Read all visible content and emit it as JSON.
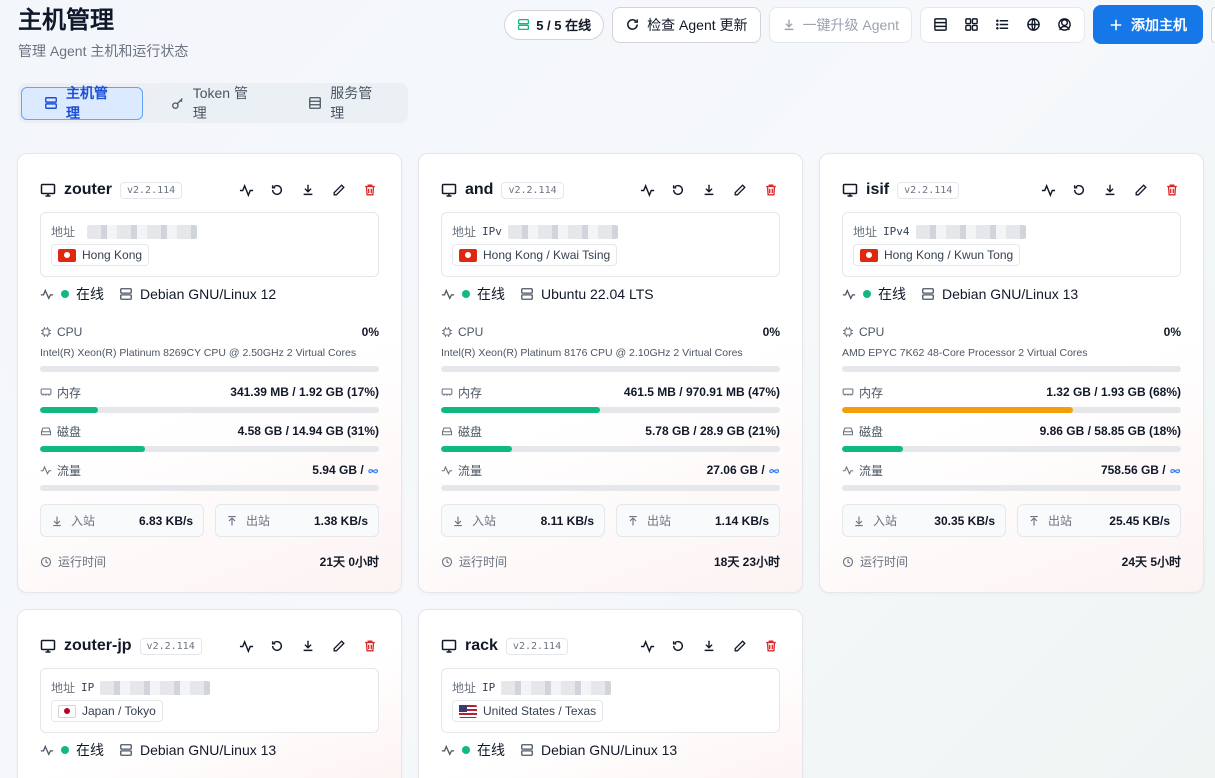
{
  "page": {
    "title": "主机管理",
    "subtitle": "管理 Agent 主机和运行状态"
  },
  "toolbar": {
    "online_badge": "5 / 5 在线",
    "check_update": "检查 Agent 更新",
    "upgrade_all": "一键升级 Agent",
    "add_host": "添加主机"
  },
  "tabs": [
    {
      "label": "主机管理",
      "active": true
    },
    {
      "label": "Token 管理",
      "active": false
    },
    {
      "label": "服务管理",
      "active": false
    }
  ],
  "labels": {
    "address": "地址",
    "online": "在线",
    "cpu": "CPU",
    "memory": "内存",
    "disk": "磁盘",
    "traffic": "流量",
    "inbound": "入站",
    "outbound": "出站",
    "uptime": "运行时间",
    "infinity": "∞"
  },
  "colors": {
    "primary": "#1677e8",
    "green": "#10b981",
    "orange": "#f59e0b",
    "danger": "#dc2626"
  },
  "hosts": [
    {
      "name": "zouter",
      "version": "v2.2.114",
      "ip_prefix": "",
      "location": "Hong Kong",
      "flag": "hk",
      "os": "Debian GNU/Linux 12",
      "cpu_pct": "0%",
      "cpu_model": "Intel(R) Xeon(R) Platinum 8269CY CPU @ 2.50GHz 2 Virtual Cores",
      "cpu_fill": 0,
      "mem": "341.39 MB / 1.92 GB (17%)",
      "mem_fill": 17,
      "disk": "4.58 GB / 14.94 GB (31%)",
      "disk_fill": 31,
      "traffic": "5.94 GB /",
      "traffic_fill": 0,
      "in": "6.83 KB/s",
      "out": "1.38 KB/s",
      "uptime": "21天 0小时"
    },
    {
      "name": "and",
      "version": "v2.2.114",
      "ip_prefix": "IPv",
      "location": "Hong Kong / Kwai Tsing",
      "flag": "hk",
      "os": "Ubuntu 22.04 LTS",
      "cpu_pct": "0%",
      "cpu_model": "Intel(R) Xeon(R) Platinum 8176 CPU @ 2.10GHz 2 Virtual Cores",
      "cpu_fill": 0,
      "mem": "461.5 MB / 970.91 MB (47%)",
      "mem_fill": 47,
      "disk": "5.78 GB / 28.9 GB (21%)",
      "disk_fill": 21,
      "traffic": "27.06 GB /",
      "traffic_fill": 0,
      "in": "8.11 KB/s",
      "out": "1.14 KB/s",
      "uptime": "18天 23小时"
    },
    {
      "name": "isif",
      "version": "v2.2.114",
      "ip_prefix": "IPv4",
      "location": "Hong Kong / Kwun Tong",
      "flag": "hk",
      "os": "Debian GNU/Linux 13",
      "cpu_pct": "0%",
      "cpu_model": "AMD EPYC 7K62 48-Core Processor 2 Virtual Cores",
      "cpu_fill": 0,
      "mem": "1.32 GB / 1.93 GB (68%)",
      "mem_fill": 68,
      "disk": "9.86 GB / 58.85 GB (18%)",
      "disk_fill": 18,
      "traffic": "758.56 GB /",
      "traffic_fill": 0,
      "in": "30.35 KB/s",
      "out": "25.45 KB/s",
      "uptime": "24天 5小时"
    },
    {
      "name": "zouter-jp",
      "version": "v2.2.114",
      "ip_prefix": "IP",
      "location": "Japan / Tokyo",
      "flag": "jp",
      "os": "Debian GNU/Linux 13"
    },
    {
      "name": "rack",
      "version": "v2.2.114",
      "ip_prefix": "IP",
      "location": "United States / Texas",
      "flag": "us",
      "os": "Debian GNU/Linux 13"
    }
  ]
}
